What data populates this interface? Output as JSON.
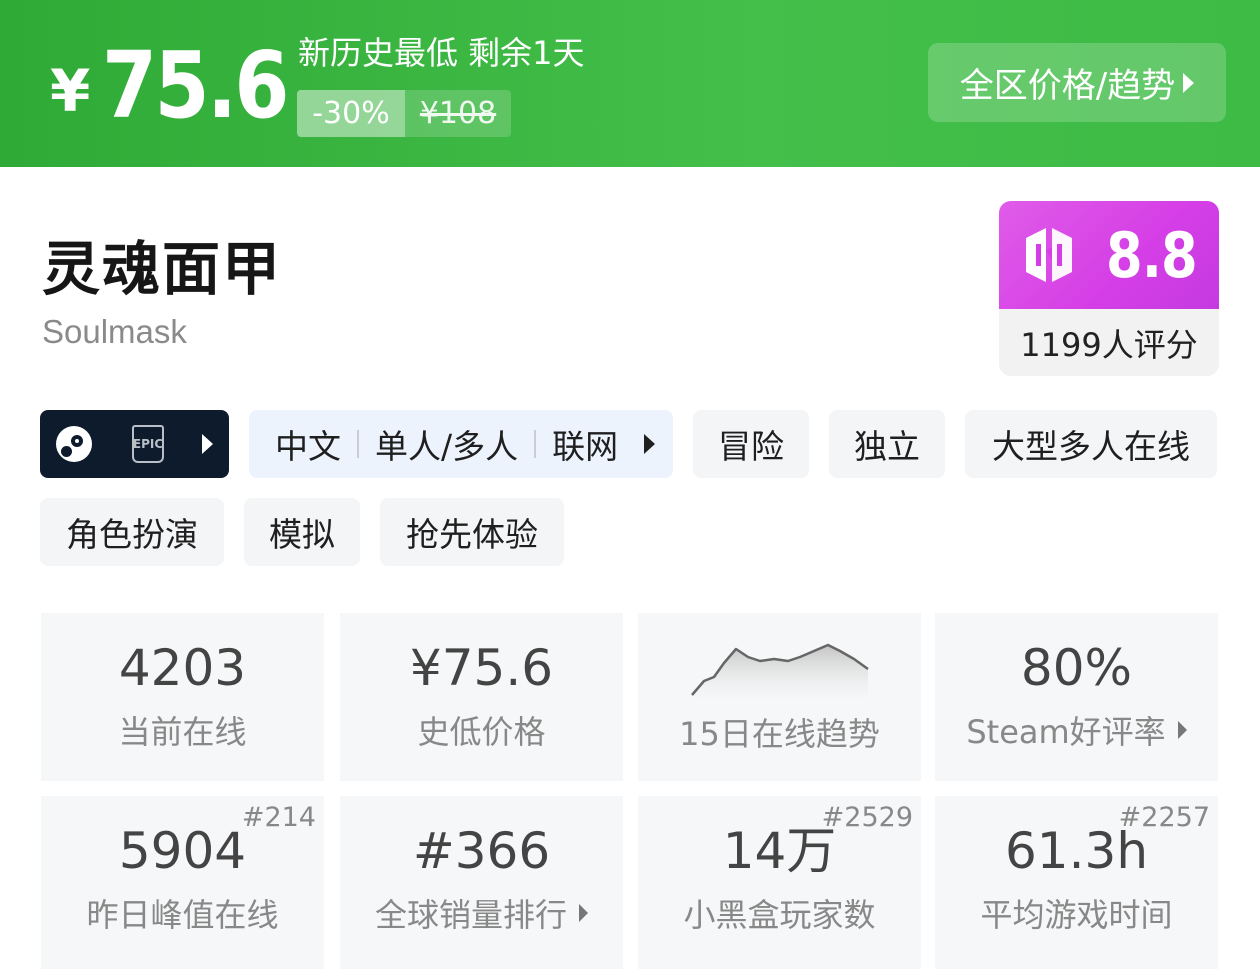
{
  "banner": {
    "currency": "¥",
    "price": "75.6",
    "deal_note": "新历史最低 剩余1天",
    "discount": "-30%",
    "original_price": "¥108",
    "trend_button": "全区价格/趋势"
  },
  "game": {
    "title_cn": "灵魂面甲",
    "title_en": "Soulmask"
  },
  "score": {
    "value": "8.8",
    "raters": "1199人评分",
    "logo_icon": "heybox-logo-icon"
  },
  "tags": {
    "stores": [
      "steam-icon",
      "epic-games-icon"
    ],
    "epic_text": "EPIC",
    "lang": [
      "中文",
      "单人/多人",
      "联网"
    ],
    "genres": [
      "冒险",
      "独立",
      "大型多人在线",
      "角色扮演",
      "模拟",
      "抢先体验"
    ]
  },
  "stats": [
    {
      "value": "4203",
      "label": "当前在线"
    },
    {
      "value": "¥75.6",
      "label": "史低价格"
    },
    {
      "label": "15日在线趋势"
    },
    {
      "value": "80%",
      "label": "Steam好评率"
    },
    {
      "value": "5904",
      "label": "昨日峰值在线",
      "rank": "#214"
    },
    {
      "value": "#366",
      "label": "全球销量排行"
    },
    {
      "value": "14万",
      "label": "小黑盒玩家数",
      "rank": "#2529"
    },
    {
      "value": "61.3h",
      "label": "平均游戏时间",
      "rank": "#2257"
    }
  ],
  "colors": {
    "banner_green": "#3dbb45",
    "score_magenta": "#d53ee6",
    "store_tag_bg": "#0d1b2d",
    "lang_tag_bg": "#edf3fd"
  }
}
